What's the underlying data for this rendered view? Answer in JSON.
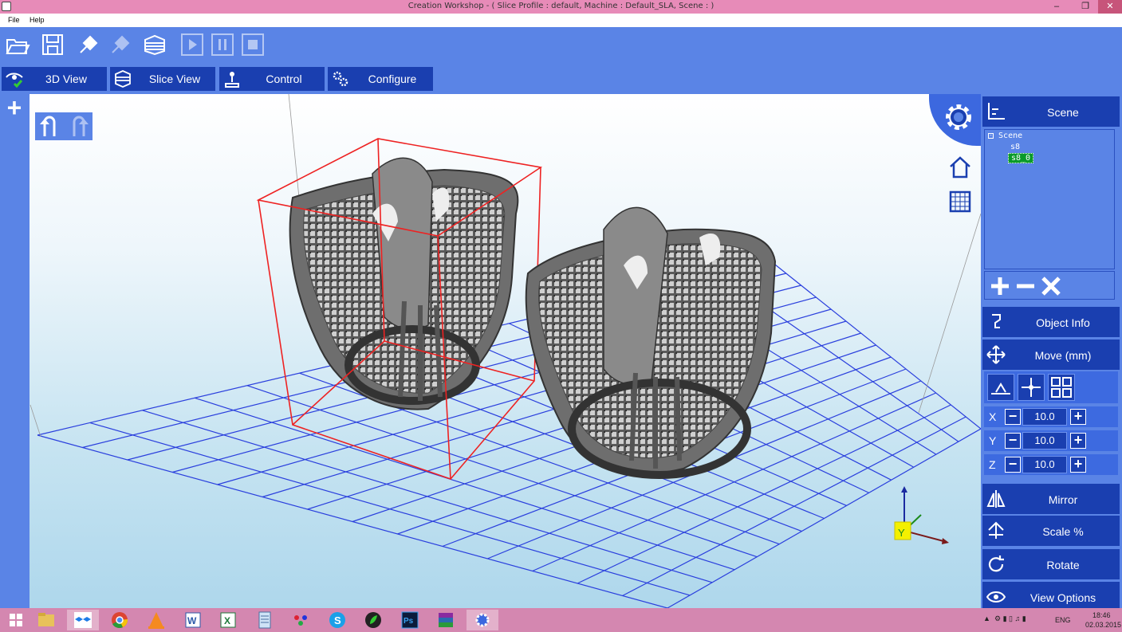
{
  "window": {
    "title": "Creation Workshop -    ( Slice Profile : default, Machine : Default_SLA, Scene : )",
    "controls": {
      "minimize": "–",
      "restore": "❐",
      "close": "✕"
    }
  },
  "menu": {
    "file": "File",
    "help": "Help"
  },
  "toolbar": {
    "icons": [
      "open-icon",
      "save-icon",
      "connect-icon",
      "disconnect-icon",
      "slice-icon",
      "play-icon",
      "pause-icon",
      "stop-icon"
    ]
  },
  "tabs": [
    {
      "label": "3D View",
      "icon": "eye-check-icon"
    },
    {
      "label": "Slice View",
      "icon": "slice-view-icon"
    },
    {
      "label": "Control",
      "icon": "joystick-icon"
    },
    {
      "label": "Configure",
      "icon": "gears-icon"
    }
  ],
  "left": {
    "add_symbol": "+"
  },
  "right_panel": {
    "scene": {
      "label": "Scene",
      "tree": {
        "root": "Scene",
        "children": [
          "s8",
          "s8_0"
        ],
        "selected": "s8_0"
      }
    },
    "object_info": {
      "label": "Object Info"
    },
    "move": {
      "label": "Move (mm)",
      "axes": [
        {
          "axis": "X",
          "value": "10.0"
        },
        {
          "axis": "Y",
          "value": "10.0"
        },
        {
          "axis": "Z",
          "value": "10.0"
        }
      ],
      "minus": "−",
      "plus": "+"
    },
    "mirror": {
      "label": "Mirror"
    },
    "scale": {
      "label": "Scale %"
    },
    "rotate": {
      "label": "Rotate"
    },
    "view_options": {
      "label": "View Options"
    }
  },
  "viewport": {
    "gizmo_label": "Y"
  },
  "taskbar": {
    "apps": [
      "windows-start-icon",
      "file-explorer-icon",
      "dropbox-icon",
      "chrome-icon",
      "vlc-icon",
      "word-icon",
      "excel-icon",
      "notepad-icon",
      "app-icon",
      "skype-icon",
      "app-green-icon",
      "photoshop-icon",
      "winrar-icon",
      "creation-workshop-icon"
    ],
    "language": "ENG",
    "time": "18:46",
    "date": "02.03.2015"
  }
}
